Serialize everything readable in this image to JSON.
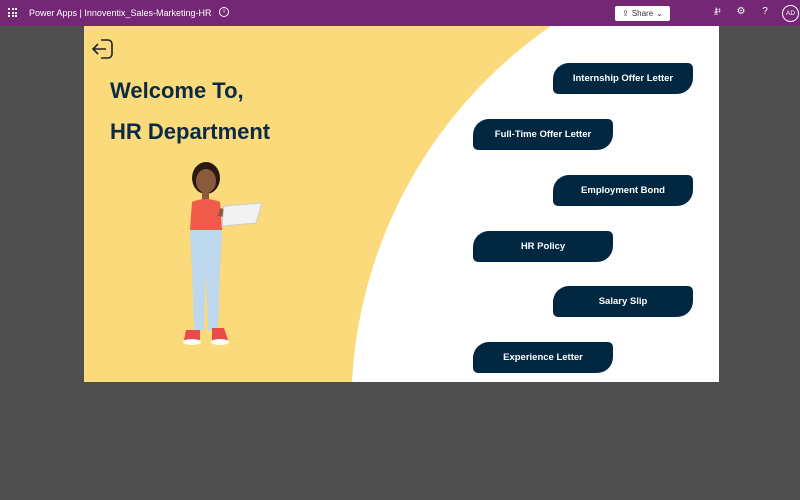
{
  "topbar": {
    "app": "Power Apps",
    "separator": "|",
    "app_name": "Innoventix_Sales-Marketing-HR",
    "share_label": "Share",
    "avatar": "AD",
    "help": "?"
  },
  "canvas": {
    "welcome": "Welcome To,",
    "department": "HR Department"
  },
  "buttons": [
    {
      "label": "Internship Offer Letter"
    },
    {
      "label": "Full-Time Offer Letter"
    },
    {
      "label": "Employment Bond"
    },
    {
      "label": "HR Policy"
    },
    {
      "label": "Salary Slip"
    },
    {
      "label": "Experience Letter"
    }
  ],
  "colors": {
    "topbar": "#742774",
    "canvas": "#FADA7A",
    "button": "#012840"
  }
}
